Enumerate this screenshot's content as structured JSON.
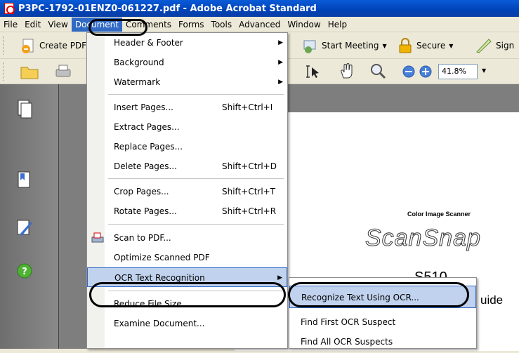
{
  "window": {
    "title": "P3PC-1792-01ENZ0-061227.pdf - Adobe Acrobat Standard"
  },
  "menubar": {
    "items": [
      "File",
      "Edit",
      "View",
      "Document",
      "Comments",
      "Forms",
      "Tools",
      "Advanced",
      "Window",
      "Help"
    ]
  },
  "toolbar1": {
    "create_pdf": "Create PDF",
    "start_meeting": "Start Meeting",
    "secure": "Secure",
    "sign": "Sign"
  },
  "toolbar2": {
    "zoom": "41.8%"
  },
  "document_menu": {
    "items": [
      {
        "label": "Header & Footer",
        "shortcut": "",
        "submenu": true
      },
      {
        "label": "Background",
        "shortcut": "",
        "submenu": true
      },
      {
        "label": "Watermark",
        "shortcut": "",
        "submenu": true
      },
      {
        "label": "Insert Pages...",
        "shortcut": "Shift+Ctrl+I"
      },
      {
        "label": "Extract Pages...",
        "shortcut": ""
      },
      {
        "label": "Replace Pages...",
        "shortcut": ""
      },
      {
        "label": "Delete Pages...",
        "shortcut": "Shift+Ctrl+D"
      },
      {
        "label": "Crop Pages...",
        "shortcut": "Shift+Ctrl+T"
      },
      {
        "label": "Rotate Pages...",
        "shortcut": "Shift+Ctrl+R"
      },
      {
        "label": "Scan to PDF...",
        "shortcut": ""
      },
      {
        "label": "Optimize Scanned PDF",
        "shortcut": ""
      },
      {
        "label": "OCR Text Recognition",
        "shortcut": "",
        "submenu": true
      },
      {
        "label": "Reduce File Size...",
        "shortcut": ""
      },
      {
        "label": "Examine Document...",
        "shortcut": ""
      }
    ]
  },
  "ocr_submenu": {
    "items": [
      "Recognize Text Using OCR...",
      "Find First OCR Suspect",
      "Find All OCR Suspects"
    ]
  },
  "document_page": {
    "scanner_label": "Color Image Scanner",
    "brand": "ScanSnap",
    "model": "S510",
    "guide_fragment": "uide"
  },
  "colors": {
    "title_blue": "#0a4fcc",
    "menu_highlight": "#c1d2ee",
    "menubar_active": "#316ac5"
  }
}
